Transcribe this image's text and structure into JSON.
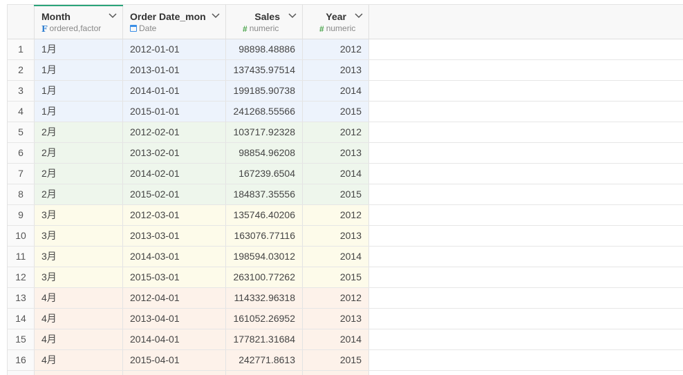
{
  "columns": [
    {
      "name": "Month",
      "type": "ordered,factor",
      "icon": "factor-icon"
    },
    {
      "name": "Order Date_mon",
      "type": "Date",
      "icon": "calendar-icon"
    },
    {
      "name": "Sales",
      "type": "numeric",
      "icon": "hash-icon"
    },
    {
      "name": "Year",
      "type": "numeric",
      "icon": "hash-icon"
    }
  ],
  "group_colors": {
    "1月": "#edf3fc",
    "2月": "#eef6ec",
    "3月": "#fdfbea",
    "4月": "#fdf2ea"
  },
  "rows": [
    {
      "index": "1",
      "month": "1月",
      "date": "2012-01-01",
      "sales": "98898.48886",
      "year": "2012"
    },
    {
      "index": "2",
      "month": "1月",
      "date": "2013-01-01",
      "sales": "137435.97514",
      "year": "2013"
    },
    {
      "index": "3",
      "month": "1月",
      "date": "2014-01-01",
      "sales": "199185.90738",
      "year": "2014"
    },
    {
      "index": "4",
      "month": "1月",
      "date": "2015-01-01",
      "sales": "241268.55566",
      "year": "2015"
    },
    {
      "index": "5",
      "month": "2月",
      "date": "2012-02-01",
      "sales": "103717.92328",
      "year": "2012"
    },
    {
      "index": "6",
      "month": "2月",
      "date": "2013-02-01",
      "sales": "98854.96208",
      "year": "2013"
    },
    {
      "index": "7",
      "month": "2月",
      "date": "2014-02-01",
      "sales": "167239.6504",
      "year": "2014"
    },
    {
      "index": "8",
      "month": "2月",
      "date": "2015-02-01",
      "sales": "184837.35556",
      "year": "2015"
    },
    {
      "index": "9",
      "month": "3月",
      "date": "2012-03-01",
      "sales": "135746.40206",
      "year": "2012"
    },
    {
      "index": "10",
      "month": "3月",
      "date": "2013-03-01",
      "sales": "163076.77116",
      "year": "2013"
    },
    {
      "index": "11",
      "month": "3月",
      "date": "2014-03-01",
      "sales": "198594.03012",
      "year": "2014"
    },
    {
      "index": "12",
      "month": "3月",
      "date": "2015-03-01",
      "sales": "263100.77262",
      "year": "2015"
    },
    {
      "index": "13",
      "month": "4月",
      "date": "2012-04-01",
      "sales": "114332.96318",
      "year": "2012"
    },
    {
      "index": "14",
      "month": "4月",
      "date": "2013-04-01",
      "sales": "161052.26952",
      "year": "2013"
    },
    {
      "index": "15",
      "month": "4月",
      "date": "2014-04-01",
      "sales": "177821.31684",
      "year": "2014"
    },
    {
      "index": "16",
      "month": "4月",
      "date": "2015-04-01",
      "sales": "242771.8613",
      "year": "2015"
    }
  ]
}
